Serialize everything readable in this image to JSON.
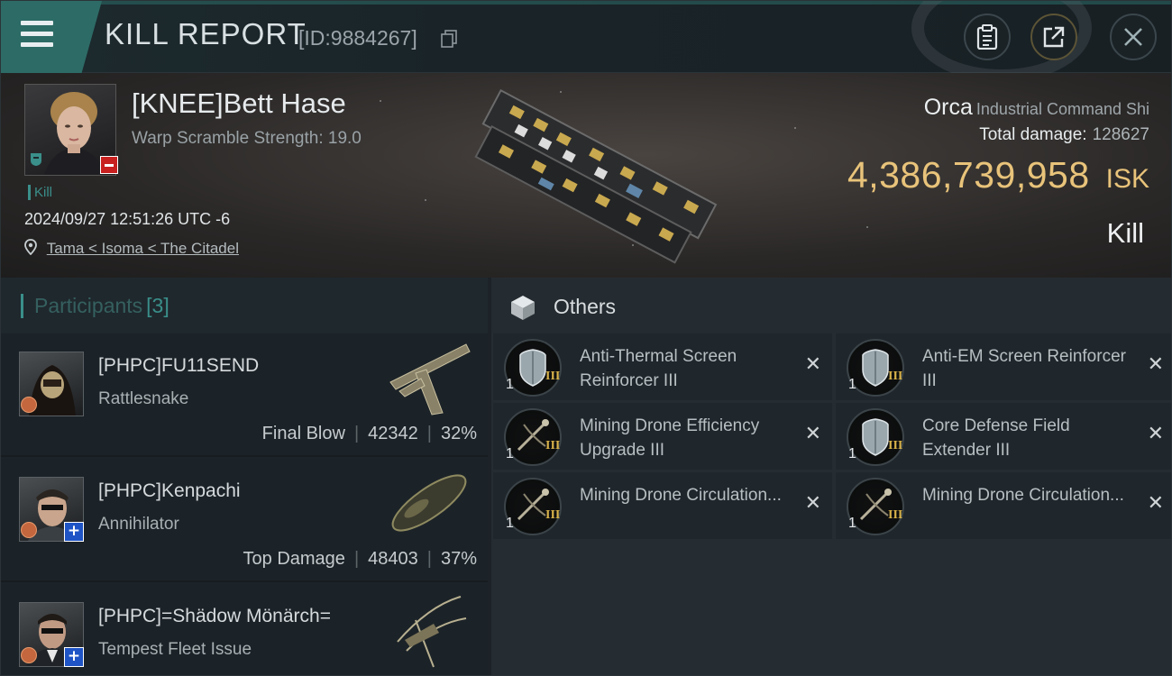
{
  "header": {
    "title": "KILL REPORT",
    "report_id": "[ID:9884267]"
  },
  "victim": {
    "name": "[KNEE]Bett Hase",
    "warp_scramble": "Warp Scramble Strength: 19.0",
    "tag": "Kill",
    "datetime": "2024/09/27 12:51:26 UTC -6",
    "location": "Tama < Isoma < The Citadel"
  },
  "summary": {
    "ship_name": "Orca",
    "ship_class": "Industrial Command Shi",
    "total_damage_label": "Total damage:",
    "total_damage_value": "128627",
    "isk_value": "4,386,739,958",
    "isk_unit": "ISK",
    "result": "Kill"
  },
  "participants": {
    "title": "Participants",
    "count": "[3]",
    "items": [
      {
        "name": "[PHPC]FU11SEND",
        "ship": "Rattlesnake",
        "role": "Final Blow",
        "damage": "42342",
        "percent": "32%"
      },
      {
        "name": "[PHPC]Kenpachi",
        "ship": "Annihilator",
        "role": "Top Damage",
        "damage": "48403",
        "percent": "37%"
      },
      {
        "name": "[PHPC]=Shädow Mönärch=",
        "ship": "Tempest Fleet Issue",
        "role": "",
        "damage": "",
        "percent": ""
      }
    ]
  },
  "others": {
    "title": "Others",
    "items": [
      {
        "name": "Anti-Thermal Screen Reinforcer III",
        "qty": "1",
        "tier": "III",
        "icon": "shield-module-icon"
      },
      {
        "name": "Anti-EM Screen Reinforcer III",
        "qty": "1",
        "tier": "III",
        "icon": "shield-module-icon"
      },
      {
        "name": "Mining Drone Efficiency Upgrade III",
        "qty": "1",
        "tier": "III",
        "icon": "drone-module-icon"
      },
      {
        "name": "Core Defense Field Extender III",
        "qty": "1",
        "tier": "III",
        "icon": "shield-module-icon"
      },
      {
        "name": "Mining Drone Circulation...",
        "qty": "1",
        "tier": "III",
        "icon": "drone-module-icon"
      },
      {
        "name": "Mining Drone Circulation...",
        "qty": "1",
        "tier": "III",
        "icon": "drone-module-icon"
      }
    ]
  },
  "colors": {
    "accent": "#3a8f8a",
    "isk_gold": "#e8c37a",
    "badge_red": "#c81f1f",
    "badge_blue": "#1f54c6"
  }
}
